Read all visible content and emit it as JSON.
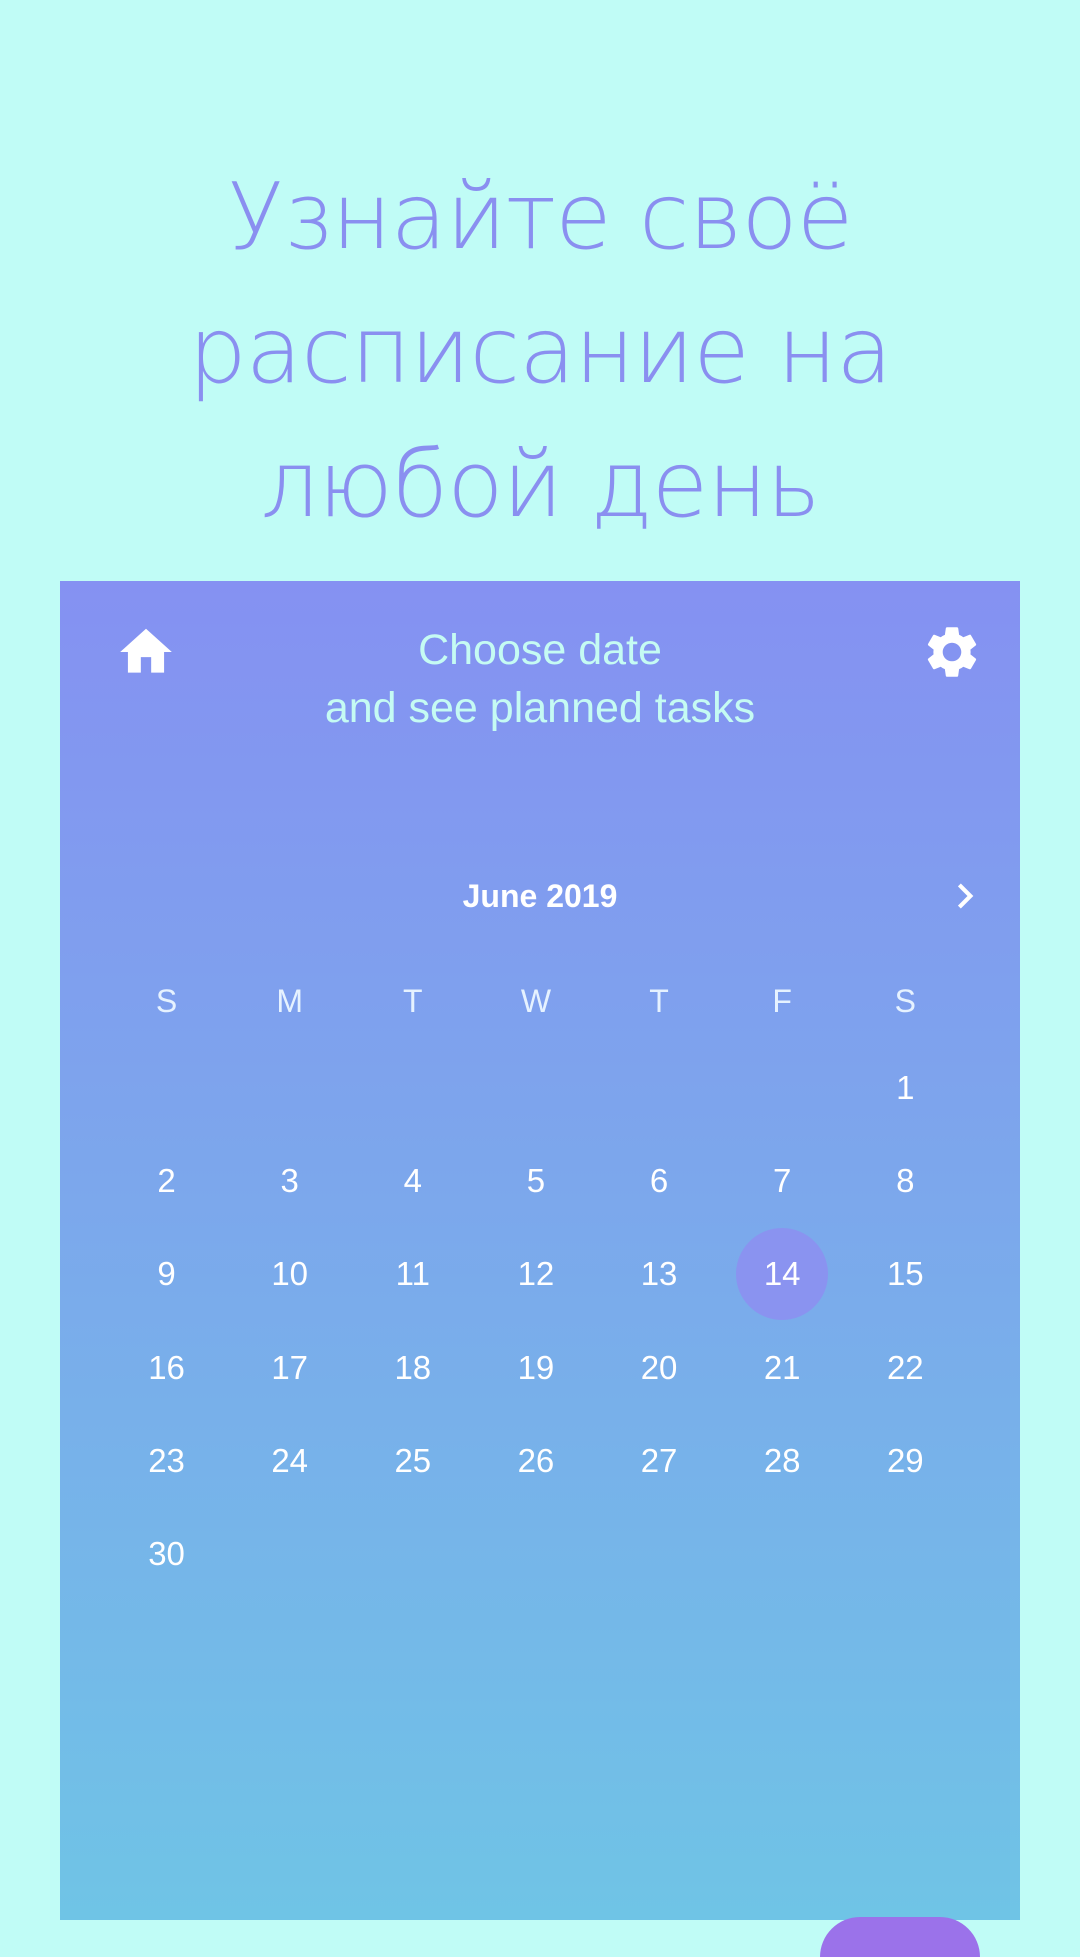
{
  "promo": {
    "line1": "Узнайте своё",
    "line2": "расписание на",
    "line3": "любой день"
  },
  "header": {
    "line1": "Choose date",
    "line2": "and see planned tasks",
    "home_icon": "home-icon",
    "settings_icon": "gear-icon"
  },
  "calendar": {
    "month": "June 2019",
    "next_icon": "chevron-right-icon",
    "weekdays": [
      "S",
      "M",
      "T",
      "W",
      "T",
      "F",
      "S"
    ],
    "weeks": [
      [
        "",
        "",
        "",
        "",
        "",
        "",
        "1"
      ],
      [
        "2",
        "3",
        "4",
        "5",
        "6",
        "7",
        "8"
      ],
      [
        "9",
        "10",
        "11",
        "12",
        "13",
        "14",
        "15"
      ],
      [
        "16",
        "17",
        "18",
        "19",
        "20",
        "21",
        "22"
      ],
      [
        "23",
        "24",
        "25",
        "26",
        "27",
        "28",
        "29"
      ],
      [
        "30",
        "",
        "",
        "",
        "",
        "",
        ""
      ]
    ],
    "selected_day": "14"
  },
  "colors": {
    "page_background": "#c0fcf6",
    "promo_text": "#8a8ff0",
    "gradient_top": "#8591f2",
    "gradient_bottom": "#6fc4e6",
    "header_text": "#c5fbf3",
    "selected_day": "#8a93f0"
  }
}
